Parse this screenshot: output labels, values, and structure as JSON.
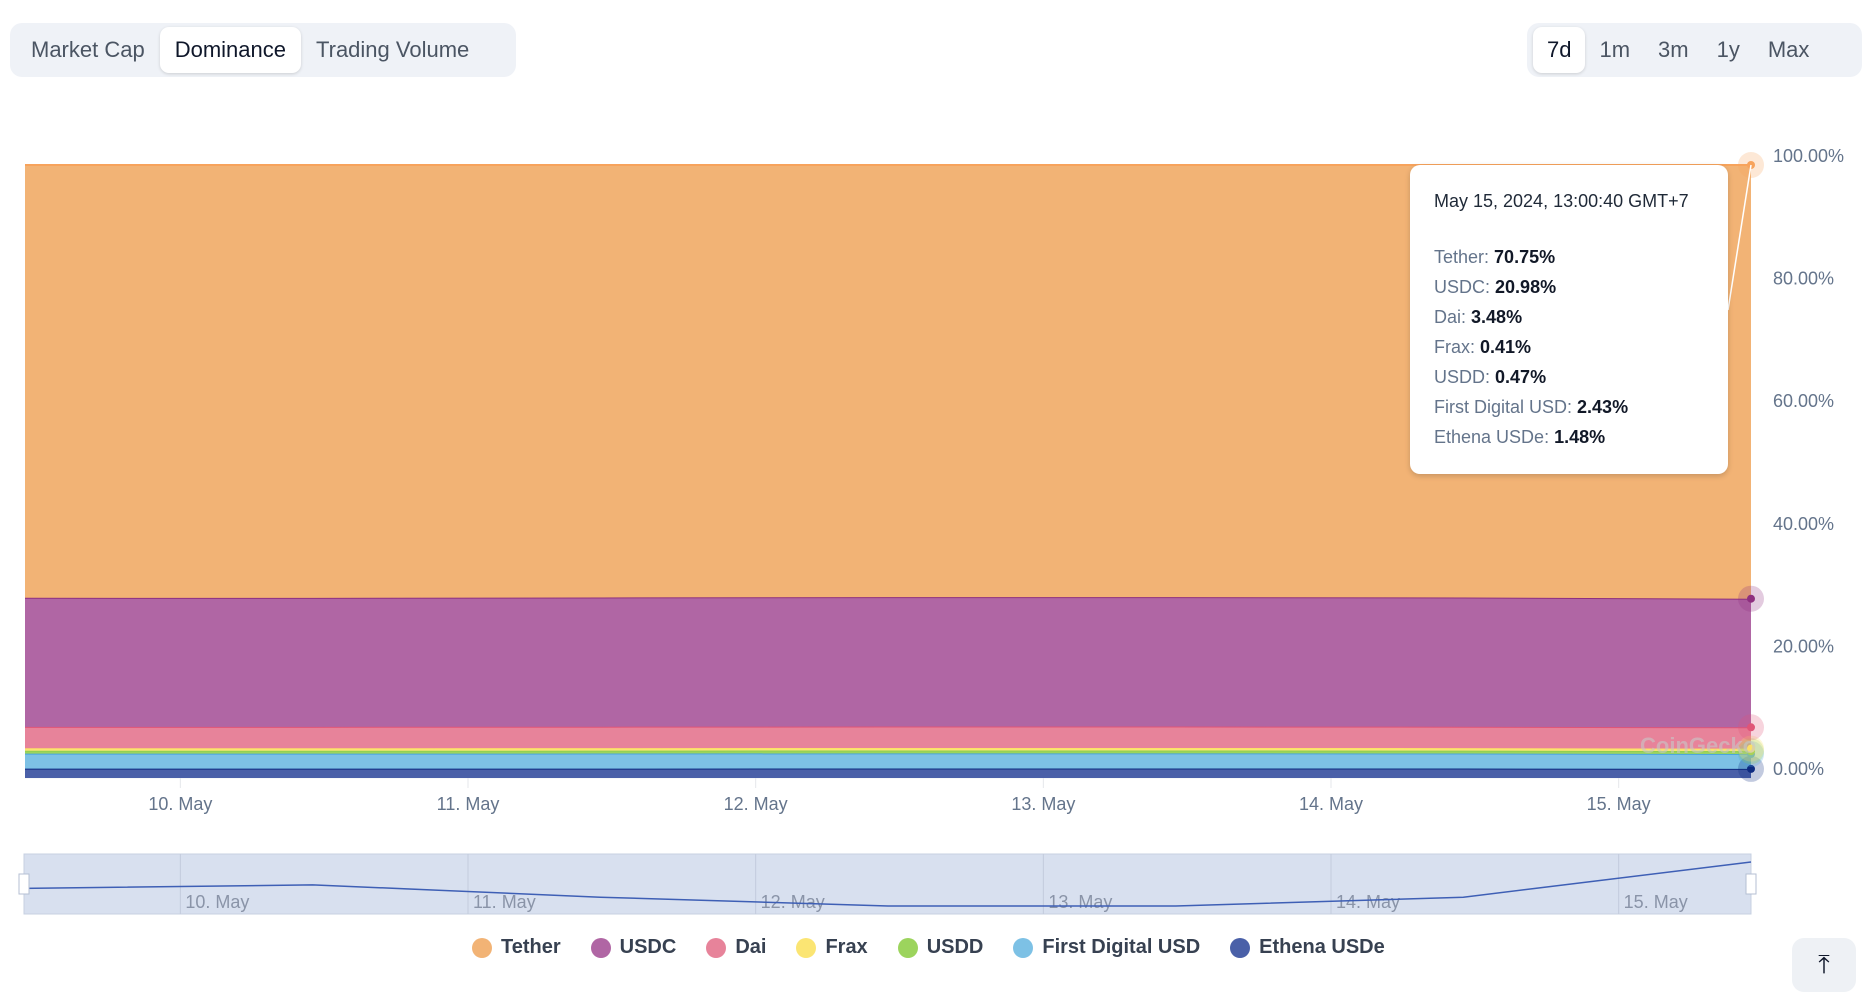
{
  "tabs": [
    {
      "label": "Market Cap"
    },
    {
      "label": "Dominance",
      "active": true
    },
    {
      "label": "Trading Volume"
    }
  ],
  "ranges": [
    {
      "label": "7d",
      "active": true
    },
    {
      "label": "1m"
    },
    {
      "label": "3m"
    },
    {
      "label": "1y"
    },
    {
      "label": "Max"
    }
  ],
  "watermark": "CoinGecko",
  "tooltip": {
    "date": "May 15, 2024, 13:00:40 GMT+7",
    "rows": [
      {
        "name": "Tether",
        "value": "70.75%"
      },
      {
        "name": "USDC",
        "value": "20.98%"
      },
      {
        "name": "Dai",
        "value": "3.48%"
      },
      {
        "name": "Frax",
        "value": "0.41%"
      },
      {
        "name": "USDD",
        "value": "0.47%"
      },
      {
        "name": "First Digital USD",
        "value": "2.43%"
      },
      {
        "name": "Ethena USDe",
        "value": "1.48%"
      }
    ]
  },
  "back_to_top_icon": "arrow-up-to-line-icon",
  "chart_data": {
    "type": "area",
    "stacking": "percent",
    "x": [
      "2024-05-09 13:00",
      "2024-05-10 13:00",
      "2024-05-11 13:00",
      "2024-05-12 13:00",
      "2024-05-13 13:00",
      "2024-05-14 13:00",
      "2024-05-15 13:00"
    ],
    "x_ticks": [
      "10. May",
      "11. May",
      "12. May",
      "13. May",
      "14. May",
      "15. May"
    ],
    "y_ticks": [
      "0.00%",
      "20.00%",
      "40.00%",
      "60.00%",
      "80.00%",
      "100.00%"
    ],
    "ylim": [
      0,
      100
    ],
    "grid": true,
    "legend": "bottom",
    "series": [
      {
        "name": "Tether",
        "color": "#f7a35c",
        "fill": "#f2b375",
        "values": [
          70.6,
          70.62,
          70.55,
          70.5,
          70.5,
          70.55,
          70.75
        ]
      },
      {
        "name": "USDC",
        "color": "#8e2f7f",
        "fill": "#b066a4",
        "values": [
          21.05,
          21.03,
          21.08,
          21.1,
          21.1,
          21.08,
          20.98
        ]
      },
      {
        "name": "Dai",
        "color": "#e05577",
        "fill": "#e7839a",
        "values": [
          3.5,
          3.5,
          3.5,
          3.5,
          3.5,
          3.49,
          3.48
        ]
      },
      {
        "name": "Frax",
        "color": "#fbe066",
        "fill": "#fbe573",
        "values": [
          0.41,
          0.41,
          0.41,
          0.41,
          0.41,
          0.41,
          0.41
        ]
      },
      {
        "name": "USDD",
        "color": "#8fce4f",
        "fill": "#9cd45d",
        "values": [
          0.47,
          0.47,
          0.47,
          0.47,
          0.47,
          0.47,
          0.47
        ]
      },
      {
        "name": "First Digital USD",
        "color": "#4aa5dd",
        "fill": "#7dc1e5",
        "values": [
          2.45,
          2.45,
          2.46,
          2.47,
          2.47,
          2.46,
          2.43
        ]
      },
      {
        "name": "Ethena USDe",
        "color": "#0d2a80",
        "fill": "#4a60a8",
        "values": [
          1.52,
          1.52,
          1.53,
          1.55,
          1.55,
          1.54,
          1.48
        ]
      }
    ]
  }
}
